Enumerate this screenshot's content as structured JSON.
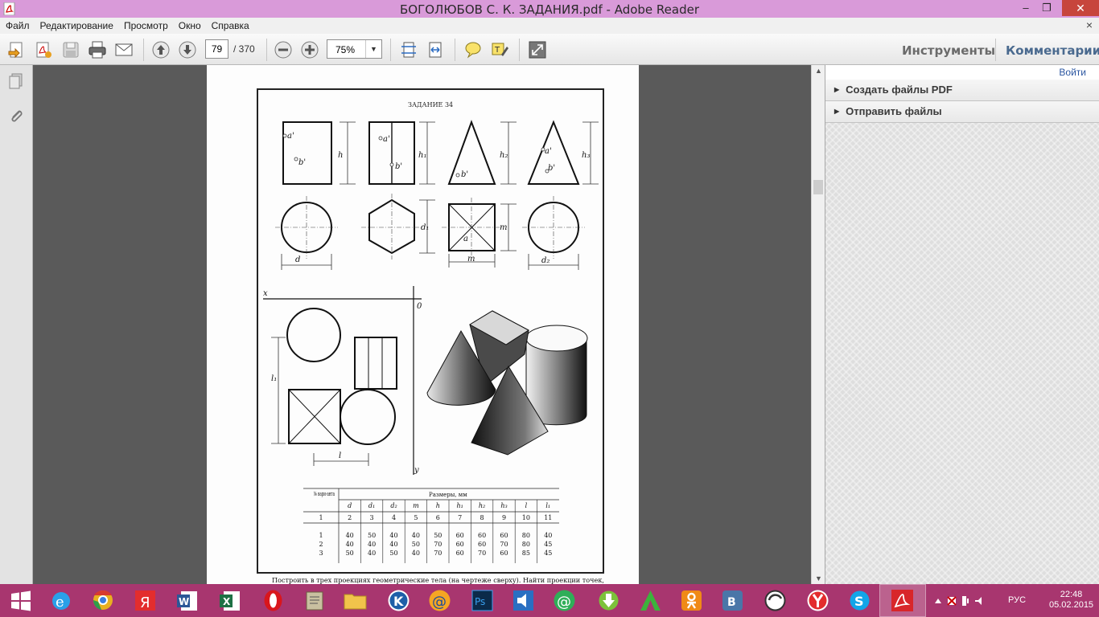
{
  "window": {
    "title": "БОГОЛЮБОВ С. К. ЗАДАНИЯ.pdf - Adobe Reader",
    "minimize": "–",
    "restore": "❐",
    "close": "✕"
  },
  "menu": {
    "items": [
      "Файл",
      "Редактирование",
      "Просмотр",
      "Окно",
      "Справка"
    ],
    "close": "×"
  },
  "toolbar": {
    "page_current": "79",
    "page_total": "/ 370",
    "zoom": "75%",
    "tools_tab": "Инструменты",
    "comments_tab": "Комментарии"
  },
  "right_pane": {
    "sign_in": "Войти",
    "panels": [
      {
        "label": "Создать файлы PDF"
      },
      {
        "label": "Отправить файлы"
      }
    ]
  },
  "document": {
    "task_title": "ЗАДАНИЕ 34",
    "proj_labels": {
      "h": "h",
      "h1": "h₁",
      "h2": "h₂",
      "h3": "h₃",
      "a": "a'",
      "b": "b'",
      "d": "d",
      "d1": "d₁",
      "d2": "d₂",
      "m": "m",
      "a_plan": "a",
      "x": "x",
      "y": "y",
      "o": "0",
      "l": "l",
      "l1": "l₁"
    },
    "table": {
      "col_variant": "№ вари-анта",
      "header_sizes": "Размеры, мм",
      "columns": [
        "d",
        "d₁",
        "d₂",
        "m",
        "h",
        "h₁",
        "h₂",
        "h₃",
        "l",
        "l₁"
      ],
      "col_numbers": [
        "1",
        "2",
        "3",
        "4",
        "5",
        "6",
        "7",
        "8",
        "9",
        "10",
        "11"
      ],
      "rows": [
        [
          "1",
          "40",
          "50",
          "40",
          "40",
          "50",
          "60",
          "60",
          "60",
          "80",
          "40"
        ],
        [
          "2",
          "40",
          "40",
          "40",
          "50",
          "70",
          "60",
          "60",
          "70",
          "80",
          "45"
        ],
        [
          "3",
          "50",
          "40",
          "50",
          "40",
          "70",
          "60",
          "70",
          "60",
          "85",
          "45"
        ]
      ]
    },
    "caption": "Построить в трех проекциях геометрические тела (на чертеже сверху). Найти проекции точек,"
  },
  "taskbar": {
    "lang": "РУС",
    "time": "22:48",
    "date": "05.02.2015",
    "apps": [
      "start-icon",
      "ie-icon",
      "chrome-icon",
      "yandex-icon",
      "word-icon",
      "excel-icon",
      "opera-icon",
      "notepad-icon",
      "explorer-icon",
      "k-icon",
      "mail-icon",
      "photoshop-icon",
      "speaker-icon",
      "at-icon",
      "download-icon",
      "green-a-icon",
      "odnoklassniki-icon",
      "vk-icon",
      "circle-icon",
      "yandex-browser-icon",
      "skype-icon",
      "acrobat-icon"
    ]
  }
}
